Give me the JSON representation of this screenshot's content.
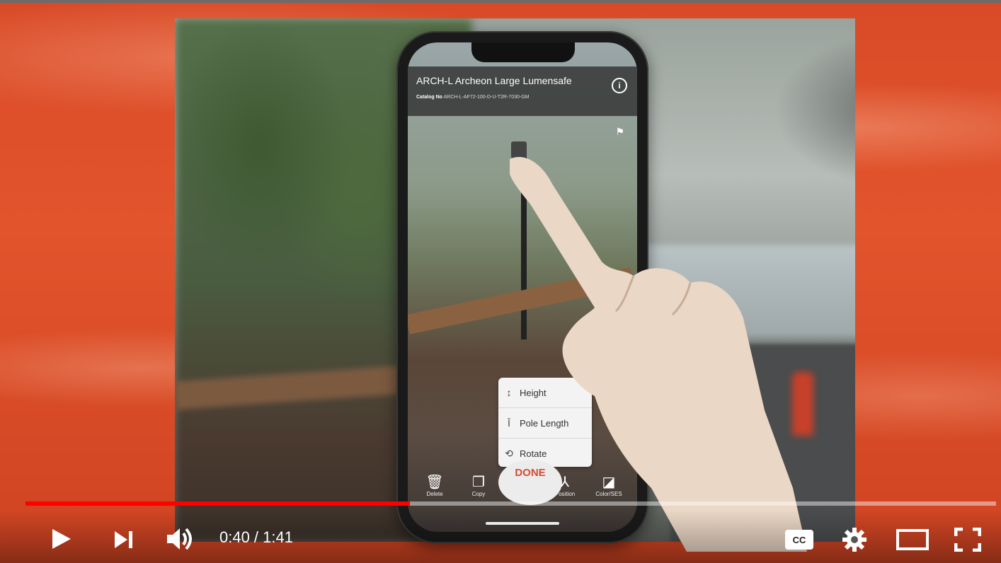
{
  "app": {
    "title": "ARCH-L Archeon Large Lumensafe",
    "catalog_label": "Catalog No",
    "catalog_value": "ARCH-L-AF72-100-D-U-T2R-7030-GM"
  },
  "menu": {
    "items": [
      {
        "icon": "height-icon",
        "label": "Height"
      },
      {
        "icon": "pole-length-icon",
        "label": "Pole Length"
      },
      {
        "icon": "rotate-icon",
        "label": "Rotate"
      }
    ],
    "done_label": "DONE"
  },
  "toolbar": {
    "items": [
      {
        "icon": "delete-icon",
        "label": "Delete"
      },
      {
        "icon": "copy-icon",
        "label": "Copy"
      },
      {
        "icon": "position-icon",
        "label": "Position"
      },
      {
        "icon": "color-icon",
        "label": "Color/SES"
      }
    ]
  },
  "player": {
    "time_display": "0:40 / 1:41",
    "progress": 0.396,
    "accent_color": "#ff0000",
    "controls": [
      "play-icon",
      "next-icon",
      "volume-icon",
      "captions-icon",
      "settings-icon",
      "theater-icon",
      "fullscreen-icon"
    ]
  }
}
